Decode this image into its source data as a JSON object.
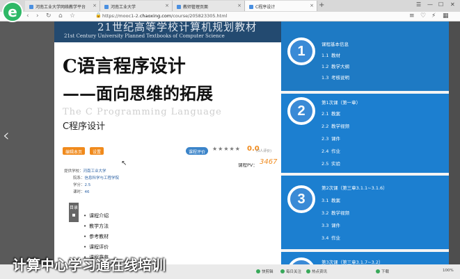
{
  "browser": {
    "tabs": [
      {
        "label": "河南工业大学网络教学平台"
      },
      {
        "label": "河南工业大学"
      },
      {
        "label": "教师管理页面"
      },
      {
        "label": "C程序设计"
      }
    ],
    "url_prefix": "https://mooc1-2.",
    "url_domain": "chaoxing.com",
    "url_path": "/course/205823305.html",
    "new_tab": "+",
    "close": "×"
  },
  "book": {
    "series_cn": "21世纪高等学校计算机规划教材",
    "series_en": "21st Century University Planned Textbooks of Computer Science",
    "title": "C语言程序设计",
    "subtitle": "——面向思维的拓展",
    "title_en": "The C Programming Language"
  },
  "course": {
    "name": "C程序设计",
    "edit_label": "编辑本页",
    "settings_label": "设置",
    "rate_label": "课程评价",
    "stars": "★★★★★",
    "score": "0.0",
    "rating_count": "(0人评价)",
    "pv_label": "课程PV：",
    "pv_value": "3467",
    "school_label": "提供学校：",
    "school": "河南工业大学",
    "dept_label": "院系：",
    "dept": "信息科学与工程学院",
    "credit_label": "学分：",
    "credit": "2.5",
    "hours_label": "课时：",
    "hours": "46",
    "dir_label": "目录",
    "menu": [
      "课程介绍",
      "教学方法",
      "参考教材",
      "课程评价",
      "课程章节"
    ]
  },
  "chapters": [
    {
      "num": "1",
      "title": "课程基本信息",
      "items": [
        {
          "n": "1.1",
          "t": "教材"
        },
        {
          "n": "1.2",
          "t": "教学大纲"
        },
        {
          "n": "1.3",
          "t": "考核说明"
        }
      ]
    },
    {
      "num": "2",
      "title": "第1次课（第一章）",
      "items": [
        {
          "n": "2.1",
          "t": "教案"
        },
        {
          "n": "2.2",
          "t": "教学视频"
        },
        {
          "n": "2.3",
          "t": "课件"
        },
        {
          "n": "2.4",
          "t": "作业"
        },
        {
          "n": "2.5",
          "t": "实验"
        }
      ]
    },
    {
      "num": "3",
      "title": "第2次课（第三章3.1.1~3.1.6）",
      "items": [
        {
          "n": "3.1",
          "t": "教案"
        },
        {
          "n": "3.2",
          "t": "教学视频"
        },
        {
          "n": "3.3",
          "t": "课件"
        },
        {
          "n": "3.4",
          "t": "作业"
        }
      ]
    },
    {
      "num": "4",
      "title": "第3次课（第三章3.1.7~3.2）",
      "items": []
    }
  ],
  "bottombar": {
    "items": [
      "快剪辑",
      "每日关注",
      "热点资讯",
      "下载",
      "100%"
    ]
  },
  "watermark": "计算中心学习通在线培训"
}
